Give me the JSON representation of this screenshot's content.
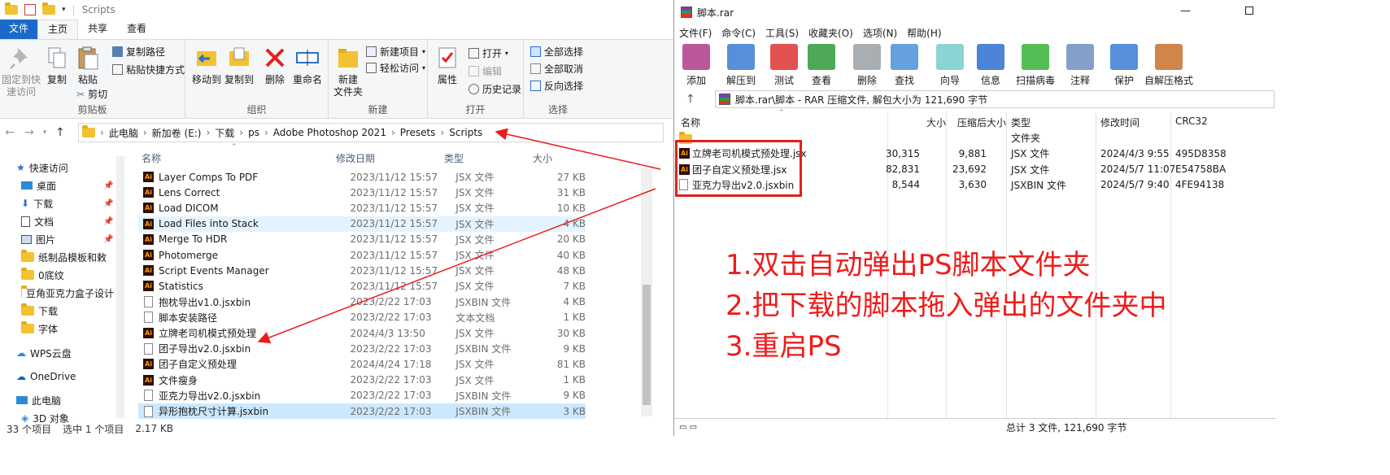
{
  "explorer": {
    "title": "Scripts",
    "tabs": [
      "文件",
      "主页",
      "共享",
      "查看"
    ],
    "ribbon": {
      "clipboard": {
        "pin": "固定到快\n速访问",
        "copy": "复制",
        "paste": "粘贴",
        "copy_path": "复制路径",
        "paste_shortcut": "粘贴快捷方式",
        "cut": "剪切",
        "label": "剪贴板"
      },
      "organize": {
        "move_to": "移动到",
        "copy_to": "复制到",
        "delete": "删除",
        "rename": "重命名",
        "label": "组织"
      },
      "new": {
        "new_folder": "新建\n文件夹",
        "new_item": "新建项目",
        "easy_access": "轻松访问",
        "label": "新建"
      },
      "open": {
        "properties": "属性",
        "open": "打开",
        "edit": "编辑",
        "history": "历史记录",
        "label": "打开"
      },
      "select": {
        "select_all": "全部选择",
        "select_none": "全部取消",
        "invert": "反向选择",
        "label": "选择"
      }
    },
    "breadcrumb": [
      "此电脑",
      "新加卷 (E:)",
      "下载",
      "ps",
      "Adobe Photoshop 2021",
      "Presets",
      "Scripts"
    ],
    "nav": [
      {
        "label": "快速访问",
        "icon": "star-icon",
        "pinned": false
      },
      {
        "label": "桌面",
        "icon": "desktop-icon",
        "pinned": true
      },
      {
        "label": "下载",
        "icon": "download-icon",
        "pinned": true
      },
      {
        "label": "文档",
        "icon": "document-icon",
        "pinned": true
      },
      {
        "label": "图片",
        "icon": "picture-icon",
        "pinned": true
      },
      {
        "label": "纸制品模板和敕",
        "icon": "folder-icon",
        "pinned": false
      },
      {
        "label": "0底纹",
        "icon": "folder-icon",
        "pinned": false
      },
      {
        "label": "豆角亚克力盒子设计",
        "icon": "folder-icon",
        "pinned": false
      },
      {
        "label": "下载",
        "icon": "folder-icon",
        "pinned": false
      },
      {
        "label": "字体",
        "icon": "folder-icon",
        "pinned": false
      },
      {
        "label": "WPS云盘",
        "icon": "cloud-icon",
        "pinned": false
      },
      {
        "label": "OneDrive",
        "icon": "onedrive-icon",
        "pinned": false
      },
      {
        "label": "此电脑",
        "icon": "pc-icon",
        "pinned": false
      },
      {
        "label": "3D 对象",
        "icon": "3d-icon",
        "pinned": false
      }
    ],
    "columns": {
      "name": "名称",
      "date": "修改日期",
      "type": "类型",
      "size": "大小"
    },
    "files": [
      {
        "name": "Layer Comps To PDF",
        "date": "2023/11/12 15:57",
        "type": "JSX 文件",
        "size": "27 KB",
        "kind": "ai"
      },
      {
        "name": "Lens Correct",
        "date": "2023/11/12 15:57",
        "type": "JSX 文件",
        "size": "31 KB",
        "kind": "ai"
      },
      {
        "name": "Load DICOM",
        "date": "2023/11/12 15:57",
        "type": "JSX 文件",
        "size": "10 KB",
        "kind": "ai"
      },
      {
        "name": "Load Files into Stack",
        "date": "2023/11/12 15:57",
        "type": "JSX 文件",
        "size": "4 KB",
        "kind": "ai"
      },
      {
        "name": "Merge To HDR",
        "date": "2023/11/12 15:57",
        "type": "JSX 文件",
        "size": "20 KB",
        "kind": "ai"
      },
      {
        "name": "Photomerge",
        "date": "2023/11/12 15:57",
        "type": "JSX 文件",
        "size": "40 KB",
        "kind": "ai"
      },
      {
        "name": "Script Events Manager",
        "date": "2023/11/12 15:57",
        "type": "JSX 文件",
        "size": "48 KB",
        "kind": "ai"
      },
      {
        "name": "Statistics",
        "date": "2023/11/12 15:57",
        "type": "JSX 文件",
        "size": "7 KB",
        "kind": "ai"
      },
      {
        "name": "抱枕导出v1.0.jsxbin",
        "date": "2023/2/22 17:03",
        "type": "JSXBIN 文件",
        "size": "4 KB",
        "kind": "doc"
      },
      {
        "name": "脚本安装路径",
        "date": "2023/2/22 17:03",
        "type": "文本文档",
        "size": "1 KB",
        "kind": "doc"
      },
      {
        "name": "立牌老司机模式预处理",
        "date": "2024/4/3 13:50",
        "type": "JSX 文件",
        "size": "30 KB",
        "kind": "ai"
      },
      {
        "name": "团子导出v2.0.jsxbin",
        "date": "2023/2/22 17:03",
        "type": "JSXBIN 文件",
        "size": "9 KB",
        "kind": "doc"
      },
      {
        "name": "团子自定义预处理",
        "date": "2024/4/24 17:18",
        "type": "JSX 文件",
        "size": "81 KB",
        "kind": "ai"
      },
      {
        "name": "文件瘦身",
        "date": "2023/2/22 17:03",
        "type": "JSX 文件",
        "size": "1 KB",
        "kind": "ai"
      },
      {
        "name": "亚克力导出v2.0.jsxbin",
        "date": "2023/2/22 17:03",
        "type": "JSXBIN 文件",
        "size": "9 KB",
        "kind": "doc"
      },
      {
        "name": "异形抱枕尺寸计算.jsxbin",
        "date": "2023/2/22 17:03",
        "type": "JSXBIN 文件",
        "size": "3 KB",
        "kind": "doc"
      }
    ],
    "status": {
      "count": "33 个项目",
      "selected": "选中 1 个项目",
      "size": "2.17 KB"
    }
  },
  "winrar": {
    "title": "脚本.rar",
    "menu": [
      "文件(F)",
      "命令(C)",
      "工具(S)",
      "收藏夹(O)",
      "选项(N)",
      "帮助(H)"
    ],
    "toolbar": [
      {
        "label": "添加",
        "icon": "add-archive-icon",
        "color": "#b03a8a"
      },
      {
        "label": "解压到",
        "icon": "extract-icon",
        "color": "#3a7bd5"
      },
      {
        "label": "测试",
        "icon": "test-icon",
        "color": "#d33"
      },
      {
        "label": "查看",
        "icon": "view-icon",
        "color": "#2f9a3a"
      },
      {
        "label": "删除",
        "icon": "delete-icon",
        "color": "#9aa0a6"
      },
      {
        "label": "查找",
        "icon": "find-icon",
        "color": "#4a90d9"
      },
      {
        "label": "向导",
        "icon": "wizard-icon",
        "color": "#7cc"
      },
      {
        "label": "信息",
        "icon": "info-icon",
        "color": "#2d6fd0"
      },
      {
        "label": "扫描病毒",
        "icon": "virus-scan-icon",
        "color": "#36b336"
      },
      {
        "label": "注释",
        "icon": "comment-icon",
        "color": "#6d8fbf"
      },
      {
        "label": "保护",
        "icon": "protect-icon",
        "color": "#3a7bd5"
      },
      {
        "label": "自解压格式",
        "icon": "sfx-icon",
        "color": "#c8702a"
      }
    ],
    "path": "脚本.rar\\脚本 - RAR 压缩文件, 解包大小为 121,690 字节",
    "columns": {
      "name": "名称",
      "size": "大小",
      "packed": "压缩后大小",
      "type": "类型",
      "modified": "修改时间",
      "crc": "CRC32"
    },
    "files": [
      {
        "name": "..",
        "size": "",
        "packed": "",
        "type": "文件夹",
        "modified": "",
        "crc": "",
        "kind": "folder"
      },
      {
        "name": "立牌老司机模式预处理.jsx",
        "size": "30,315",
        "packed": "9,881",
        "type": "JSX 文件",
        "modified": "2024/4/3 9:55",
        "crc": "495D8358",
        "kind": "ai"
      },
      {
        "name": "团子自定义预处理.jsx",
        "size": "82,831",
        "packed": "23,692",
        "type": "JSX 文件",
        "modified": "2024/5/7 11:07",
        "crc": "E54758BA",
        "kind": "ai"
      },
      {
        "name": "亚克力导出v2.0.jsxbin",
        "size": "8,544",
        "packed": "3,630",
        "type": "JSXBIN 文件",
        "modified": "2024/5/7 9:40",
        "crc": "4FE94138",
        "kind": "doc"
      }
    ],
    "status": "总计 3 文件, 121,690 字节"
  },
  "instructions": [
    "1.双击自动弹出PS脚本文件夹",
    "2.把下载的脚本拖入弹出的文件夹中",
    "3.重启PS"
  ],
  "colors": {
    "annotation": "#ee1c1c",
    "selection": "#cce8ff",
    "hover": "#e5f3ff",
    "file_tab": "#1b6ac9"
  }
}
